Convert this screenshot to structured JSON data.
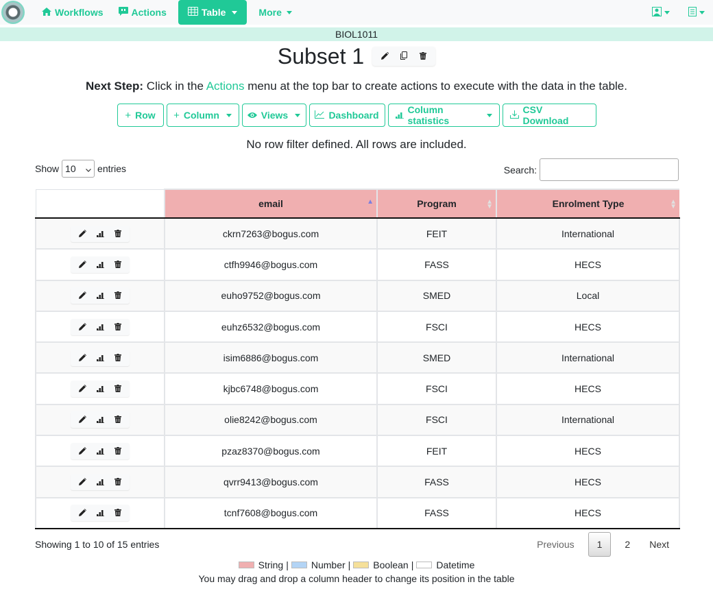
{
  "nav": {
    "items": [
      {
        "label": "Workflows",
        "icon": "home-icon"
      },
      {
        "label": "Actions",
        "icon": "comment-quote-icon"
      },
      {
        "label": "Table",
        "icon": "table-icon",
        "active": true,
        "dropdown": true
      },
      {
        "label": "More",
        "dropdown": true
      }
    ],
    "right_icons": [
      "user-profile-icon",
      "document-list-icon"
    ]
  },
  "course_code": "BIOL1011",
  "page_title": "Subset 1",
  "title_actions": [
    "edit-icon",
    "copy-icon",
    "trash-icon"
  ],
  "next_step": {
    "label": "Next Step:",
    "before": " Click in the ",
    "link": "Actions",
    "after": " menu at the top bar to create actions to execute with the data in the table."
  },
  "toolbar": {
    "row": "Row",
    "column": "Column",
    "views": "Views",
    "dashboard": "Dashboard",
    "column_statistics": "Column statistics",
    "csv_download": "CSV Download"
  },
  "filter_message": "No row filter defined. All rows are included.",
  "datatable": {
    "show_label": "Show",
    "entries_label": "entries",
    "page_length": "10",
    "search_label": "Search:",
    "search_value": "",
    "columns": [
      "",
      "email",
      "Program",
      "Enrolment Type"
    ],
    "sorted_column": "email",
    "rows": [
      {
        "email": "ckrn7263@bogus.com",
        "program": "FEIT",
        "enrolment": "International"
      },
      {
        "email": "ctfh9946@bogus.com",
        "program": "FASS",
        "enrolment": "HECS"
      },
      {
        "email": "euho9752@bogus.com",
        "program": "SMED",
        "enrolment": "Local"
      },
      {
        "email": "euhz6532@bogus.com",
        "program": "FSCI",
        "enrolment": "HECS"
      },
      {
        "email": "isim6886@bogus.com",
        "program": "SMED",
        "enrolment": "International"
      },
      {
        "email": "kjbc6748@bogus.com",
        "program": "FSCI",
        "enrolment": "HECS"
      },
      {
        "email": "olie8242@bogus.com",
        "program": "FSCI",
        "enrolment": "International"
      },
      {
        "email": "pzaz8370@bogus.com",
        "program": "FEIT",
        "enrolment": "HECS"
      },
      {
        "email": "qvrr9413@bogus.com",
        "program": "FASS",
        "enrolment": "HECS"
      },
      {
        "email": "tcnf7608@bogus.com",
        "program": "FASS",
        "enrolment": "HECS"
      }
    ],
    "info": "Showing 1 to 10 of 15 entries",
    "pagination": {
      "previous": "Previous",
      "pages": [
        "1",
        "2"
      ],
      "current": "1",
      "next": "Next"
    }
  },
  "legend": [
    {
      "label": "String",
      "color": "#f0afb0"
    },
    {
      "label": "Number",
      "color": "#b3d4f5"
    },
    {
      "label": "Boolean",
      "color": "#f5e09a"
    },
    {
      "label": "Datetime",
      "color": "#ffffff"
    }
  ],
  "legend_separator": "|",
  "hint": "You may drag and drop a column header to change its position in the table",
  "colors": {
    "accent": "#20c997",
    "string_col": "#f0afb0",
    "course_bar": "#d1f3e9"
  }
}
